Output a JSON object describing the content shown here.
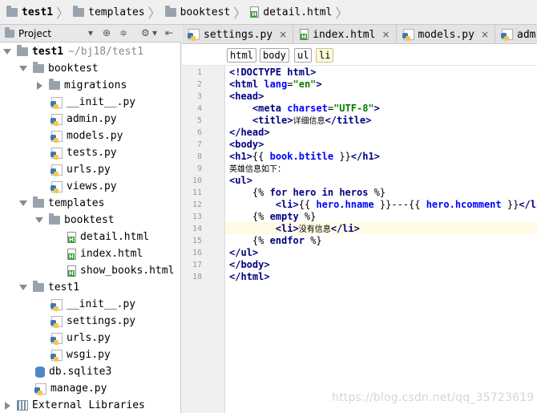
{
  "breadcrumb": [
    "test1",
    "templates",
    "booktest",
    "detail.html"
  ],
  "project_panel": {
    "title": "Project",
    "tree": [
      {
        "label": "test1",
        "hint": "~/bj18/test1"
      },
      {
        "label": "booktest"
      },
      {
        "label": "migrations"
      },
      {
        "label": "__init__.py"
      },
      {
        "label": "admin.py"
      },
      {
        "label": "models.py"
      },
      {
        "label": "tests.py"
      },
      {
        "label": "urls.py"
      },
      {
        "label": "views.py"
      },
      {
        "label": "templates"
      },
      {
        "label": "booktest"
      },
      {
        "label": "detail.html"
      },
      {
        "label": "index.html"
      },
      {
        "label": "show_books.html"
      },
      {
        "label": "test1"
      },
      {
        "label": "__init__.py"
      },
      {
        "label": "settings.py"
      },
      {
        "label": "urls.py"
      },
      {
        "label": "wsgi.py"
      },
      {
        "label": "db.sqlite3"
      },
      {
        "label": "manage.py"
      },
      {
        "label": "External Libraries"
      }
    ]
  },
  "tabs": [
    {
      "label": "settings.py",
      "close": "×"
    },
    {
      "label": "index.html",
      "close": "×"
    },
    {
      "label": "models.py",
      "close": "×"
    },
    {
      "label": "adm"
    }
  ],
  "tag_path": [
    "html",
    "body",
    "ul",
    "li"
  ],
  "editor": {
    "current_line": 14,
    "lines": [
      "<!DOCTYPE html>",
      "<html lang=\"en\">",
      "<head>",
      "    <meta charset=\"UTF-8\">",
      "    <title>详细信息</title>",
      "</head>",
      "<body>",
      "<h1>{{ book.btitle }}</h1>",
      "英雄信息如下：",
      "<ul>",
      "    {% for hero in heros %}",
      "        <li>{{ hero.hname }}---{{ hero.hcomment }}</li>",
      "    {% empty %}",
      "        <li>没有信息</li>",
      "    {% endfor %}",
      "</ul>",
      "</body>",
      "</html>"
    ]
  },
  "watermark": "https://blog.csdn.net/qq_35723619"
}
